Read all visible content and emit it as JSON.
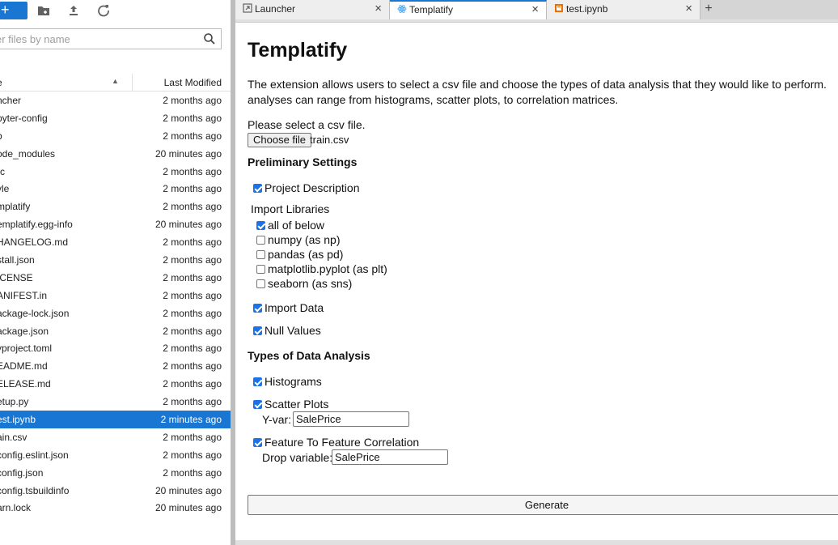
{
  "file_browser": {
    "new_label": "+",
    "filter_placeholder": "er files by name",
    "columns": {
      "name": "e",
      "last_modified": "Last Modified"
    },
    "files": [
      {
        "name": "ncher",
        "modified": "2 months ago"
      },
      {
        "name": "pyter-config",
        "modified": "2 months ago"
      },
      {
        "name": "b",
        "modified": "2 months ago"
      },
      {
        "name": "ode_modules",
        "modified": "20 minutes ago"
      },
      {
        "name": "rc",
        "modified": "2 months ago"
      },
      {
        "name": "yle",
        "modified": "2 months ago"
      },
      {
        "name": "mplatify",
        "modified": "2 months ago"
      },
      {
        "name": "emplatify.egg-info",
        "modified": "20 minutes ago"
      },
      {
        "name": "HANGELOG.md",
        "modified": "2 months ago"
      },
      {
        "name": "stall.json",
        "modified": "2 months ago"
      },
      {
        "name": "ICENSE",
        "modified": "2 months ago"
      },
      {
        "name": "ANIFEST.in",
        "modified": "2 months ago"
      },
      {
        "name": "ackage-lock.json",
        "modified": "2 months ago"
      },
      {
        "name": "ackage.json",
        "modified": "2 months ago"
      },
      {
        "name": "yproject.toml",
        "modified": "2 months ago"
      },
      {
        "name": "EADME.md",
        "modified": "2 months ago"
      },
      {
        "name": "ELEASE.md",
        "modified": "2 months ago"
      },
      {
        "name": "etup.py",
        "modified": "2 months ago"
      },
      {
        "name": "est.ipynb",
        "modified": "2 minutes ago"
      },
      {
        "name": "ain.csv",
        "modified": "2 months ago"
      },
      {
        "name": "config.eslint.json",
        "modified": "2 months ago"
      },
      {
        "name": "config.json",
        "modified": "2 months ago"
      },
      {
        "name": "config.tsbuildinfo",
        "modified": "20 minutes ago"
      },
      {
        "name": "arn.lock",
        "modified": "20 minutes ago"
      }
    ]
  },
  "tabs": [
    {
      "label": "Launcher",
      "icon": "launcher-icon"
    },
    {
      "label": "Templatify",
      "icon": "react-icon"
    },
    {
      "label": "test.ipynb",
      "icon": "notebook-icon"
    }
  ],
  "tab_close": "×",
  "tab_add": "+",
  "templatify": {
    "title": "Templatify",
    "intro": "The extension allows users to select a csv file and choose the types of data analysis that they would like to perform. analyses can range from histograms, scatter plots, to correlation matrices.",
    "csv_prompt": "Please select a csv file.",
    "choose_file_label": "Choose file",
    "chosen_file": "train.csv",
    "preliminary_title": "Preliminary Settings",
    "project_description": "Project Description",
    "import_libraries_title": "Import Libraries",
    "libraries": [
      {
        "label": "all of below",
        "checked": true
      },
      {
        "label": "numpy (as np)",
        "checked": false
      },
      {
        "label": "pandas (as pd)",
        "checked": false
      },
      {
        "label": "matplotlib.pyplot (as plt)",
        "checked": false
      },
      {
        "label": "seaborn (as sns)",
        "checked": false
      }
    ],
    "import_data": "Import Data",
    "null_values": "Null Values",
    "analysis_title": "Types of Data Analysis",
    "histograms": "Histograms",
    "scatter_plots": "Scatter Plots",
    "yvar_label": "Y-var:",
    "yvar_value": "SalePrice",
    "feature_correlation": "Feature To Feature Correlation",
    "drop_variable_label": "Drop variable:",
    "drop_variable_value": "SalePrice",
    "generate_label": "Generate"
  },
  "colors": {
    "accent": "#1976d2",
    "checkbox": "#1a73e8"
  }
}
